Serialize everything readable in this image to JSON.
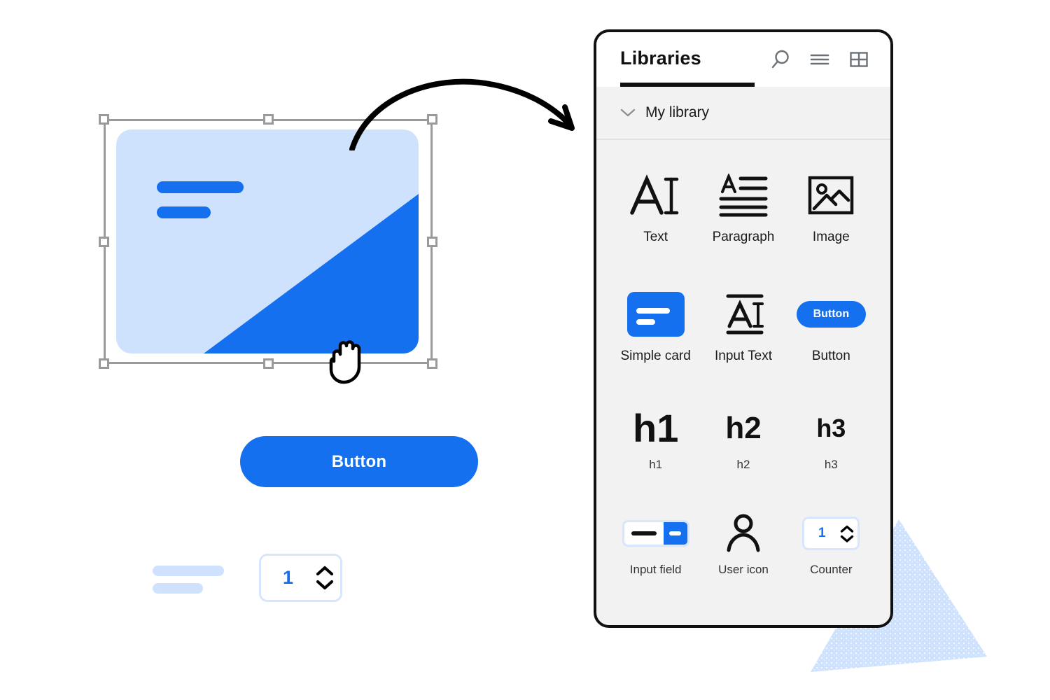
{
  "canvas": {
    "selected_object": {
      "name": "Simple card",
      "bars": [
        "bar-long",
        "bar-short"
      ],
      "fill_color": "#cfe2fd",
      "accent_color": "#1570f0",
      "selected": "true"
    },
    "button": {
      "label": "Button",
      "fill_color": "#1570f0",
      "text_color": "#ffffff"
    },
    "counter": {
      "value": "1",
      "accent_color": "#1570f0",
      "border_color": "#d7e6fd"
    },
    "cursor": "hand-cursor",
    "arrow": "curved-arrow"
  },
  "panel": {
    "title": "Libraries",
    "header_icons": [
      {
        "name": "search-icon",
        "label": "Search"
      },
      {
        "name": "list-view-icon",
        "label": "List view"
      },
      {
        "name": "grid-view-icon",
        "label": "Grid view"
      }
    ],
    "section": {
      "label": "My library",
      "expanded": "true",
      "chevron": "chevron-down-icon"
    },
    "border_color": "#111111",
    "background_color": "#f2f2f2",
    "components": [
      {
        "label": "Text",
        "icon": "text-icon"
      },
      {
        "label": "Paragraph",
        "icon": "paragraph-icon"
      },
      {
        "label": "Image",
        "icon": "image-icon"
      },
      {
        "label": "Simple card",
        "icon": "simple-card-icon"
      },
      {
        "label": "Input Text",
        "icon": "input-text-icon"
      },
      {
        "label": "Button",
        "icon": "button-icon",
        "thumb_label": "Button"
      },
      {
        "label": "h1",
        "icon": "heading-1-icon",
        "thumb_label": "h1"
      },
      {
        "label": "h2",
        "icon": "heading-2-icon",
        "thumb_label": "h2"
      },
      {
        "label": "h3",
        "icon": "heading-3-icon",
        "thumb_label": "h3"
      },
      {
        "label": "Input field",
        "icon": "input-field-icon"
      },
      {
        "label": "User icon",
        "icon": "user-icon"
      },
      {
        "label": "Counter",
        "icon": "counter-icon",
        "thumb_value": "1"
      }
    ]
  },
  "decoration": {
    "triangle": "speckled-triangle",
    "triangle_color": "#cfe2fd"
  }
}
